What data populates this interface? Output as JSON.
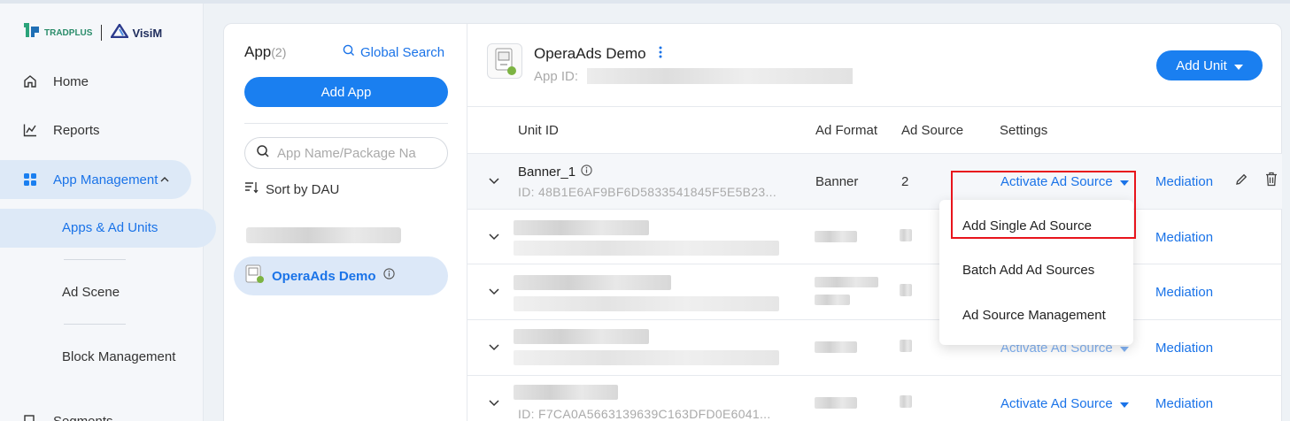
{
  "brand": {
    "logo_left": "TRADPLUS",
    "logo_right": "VisiM"
  },
  "sidebar": {
    "items": [
      {
        "label": "Home",
        "icon": "home-icon"
      },
      {
        "label": "Reports",
        "icon": "chart-line-icon"
      },
      {
        "label": "App Management",
        "icon": "grid-icon"
      }
    ],
    "sub_items": [
      {
        "label": "Apps & Ad Units"
      },
      {
        "label": "Ad Scene"
      },
      {
        "label": "Block Management"
      }
    ],
    "partial_item": "Segments"
  },
  "applist": {
    "title": "App",
    "count": "(2)",
    "global_search": "Global Search",
    "add_app": "Add App",
    "search_placeholder": "App Name/Package Na",
    "sort": "Sort by DAU",
    "selected_app": "OperaAds Demo"
  },
  "detail": {
    "app_name": "OperaAds Demo",
    "app_id_label": "App ID:",
    "add_unit": "Add Unit",
    "columns": {
      "unit_id": "Unit ID",
      "ad_format": "Ad Format",
      "ad_source": "Ad Source",
      "settings": "Settings"
    },
    "rows": [
      {
        "name": "Banner_1",
        "id": "ID: 48B1E6AF9BF6D5833541845F5E5B23...",
        "format": "Banner",
        "source": "2",
        "activate": "Activate Ad Source",
        "mediation": "Mediation"
      },
      {
        "mediation": "Mediation"
      },
      {
        "mediation": "Mediation"
      },
      {
        "activate": "Activate Ad Source",
        "mediation": "Mediation"
      },
      {
        "id": "ID: F7CA0A5663139639C163DFD0E6041...",
        "activate": "Activate Ad Source",
        "mediation": "Mediation"
      }
    ]
  },
  "dropdown": {
    "items": [
      "Add Single Ad Source",
      "Batch Add Ad Sources",
      "Ad Source Management"
    ]
  },
  "colors": {
    "accent": "#1a7ff0",
    "highlight_box": "#e8141c",
    "active_nav": "#dde9f7"
  }
}
